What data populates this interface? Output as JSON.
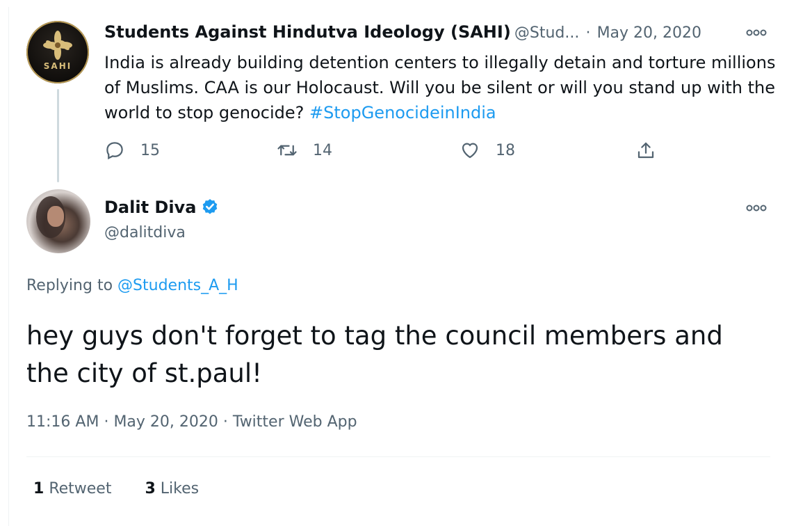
{
  "original_tweet": {
    "display_name": "Students Against Hindutva Ideology (SAHI)",
    "handle": "@Stud...",
    "separator": "·",
    "date": "May 20, 2020",
    "avatar_text": "SAHI",
    "text_plain": "India is already building detention centers to illegally detain and torture millions of Muslims. CAA is our Holocaust. Will you be silent or will you stand up with the world to stop genocide?",
    "hashtag": "#StopGenocideinIndia",
    "replies": "15",
    "retweets": "14",
    "likes": "18"
  },
  "reply_tweet": {
    "display_name": "Dalit Diva",
    "handle": "@dalitdiva",
    "verified": true,
    "replying_prefix": "Replying to",
    "replying_to": "@Students_A_H",
    "text": "hey guys don't forget to tag the council members and the city of st.paul!",
    "time": "11:16 AM",
    "date": "May 20, 2020",
    "source": "Twitter Web App",
    "sep": "·",
    "retweet_count": "1",
    "retweet_label": "Retweet",
    "like_count": "3",
    "like_label": "Likes"
  },
  "icons": {
    "more": "more-icon",
    "reply": "reply-icon",
    "retweet": "retweet-icon",
    "like": "heart-icon",
    "share": "share-icon",
    "verified": "verified-badge-icon"
  },
  "colors": {
    "link": "#1d9bf0",
    "muted": "#536471",
    "text": "#0f1419"
  }
}
